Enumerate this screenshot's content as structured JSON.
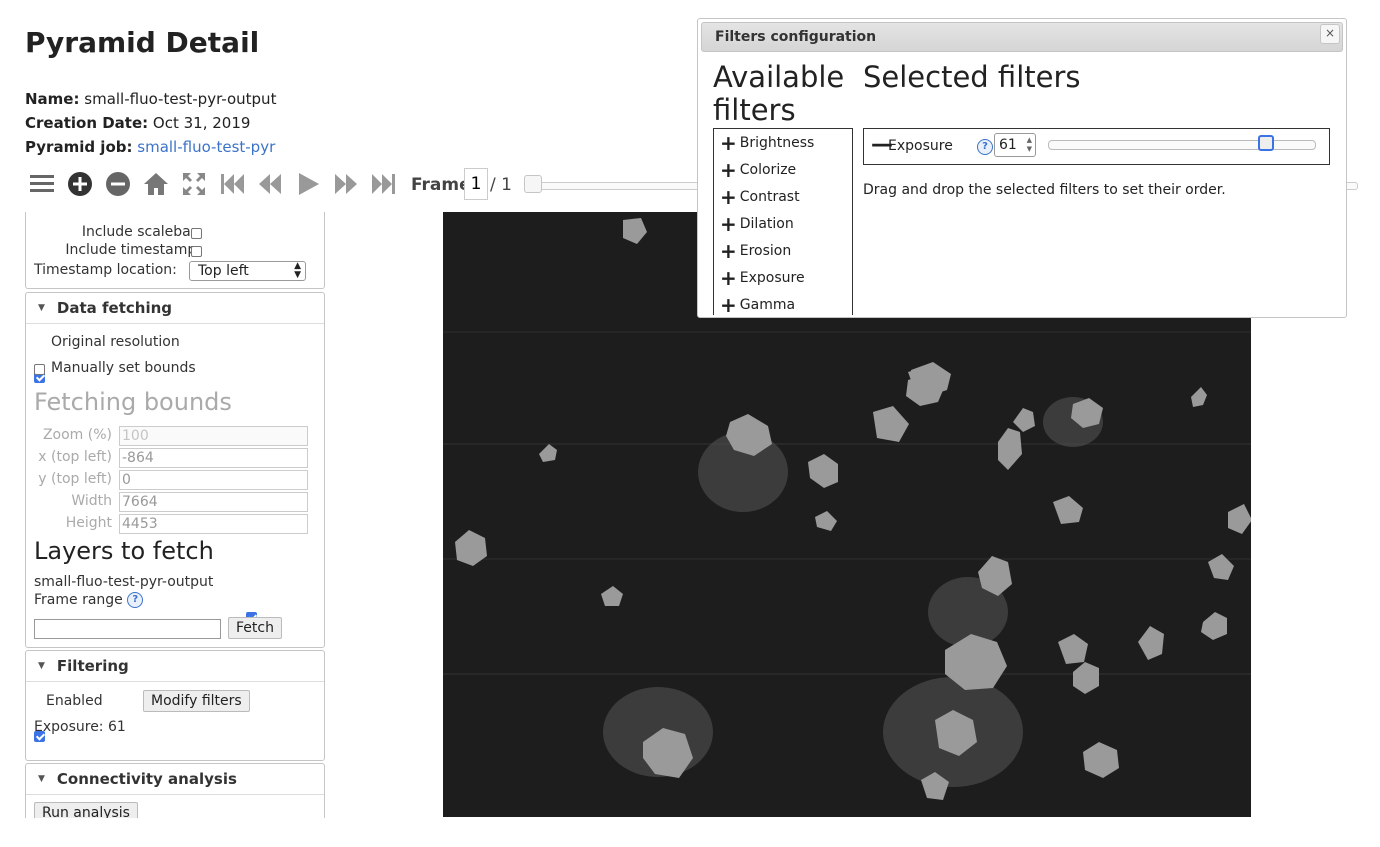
{
  "page": {
    "title": "Pyramid Detail",
    "name_label": "Name:",
    "name_value": "small-fluo-test-pyr-output",
    "date_label": "Creation Date:",
    "date_value": "Oct 31, 2019",
    "job_label": "Pyramid job:",
    "job_value": "small-fluo-test-pyr"
  },
  "toolbar": {
    "icons": [
      "menu-icon",
      "zoom-in-icon",
      "zoom-out-icon",
      "home-icon",
      "fullscreen-icon",
      "first-frame-icon",
      "previous-frame-icon",
      "play-icon",
      "next-frame-icon",
      "last-frame-icon"
    ],
    "frame_label": "Frame",
    "frame_value": "1",
    "frame_total": "/ 1"
  },
  "export_panel": {
    "scalebar_label": "Include scalebar:",
    "timestamp_label": "Include timestamp:",
    "timestamp_location_label": "Timestamp location:",
    "timestamp_location_value": "Top left"
  },
  "data_fetching": {
    "header": "Data fetching",
    "original_resolution": "Original resolution",
    "manual_bounds": "Manually set bounds",
    "bounds_title": "Fetching bounds",
    "fields": [
      {
        "label": "Zoom (%)",
        "value": "100"
      },
      {
        "label": "x (top left)",
        "value": "-864"
      },
      {
        "label": "y (top left)",
        "value": "0"
      },
      {
        "label": "Width",
        "value": "7664"
      },
      {
        "label": "Height",
        "value": "4453"
      }
    ],
    "layers_title": "Layers to fetch",
    "layer_name": "small-fluo-test-pyr-output",
    "frame_range_label": "Frame range",
    "fetch_button": "Fetch"
  },
  "filtering": {
    "header": "Filtering",
    "enabled_label": "Enabled",
    "modify_button": "Modify filters",
    "exposure_text": "Exposure: 61"
  },
  "connectivity": {
    "header": "Connectivity analysis",
    "run_button": "Run analysis"
  },
  "dialog": {
    "title": "Filters configuration",
    "close": "×",
    "available_title": "Available filters",
    "selected_title": "Selected filters",
    "available": [
      "Brightness",
      "Colorize",
      "Contrast",
      "Dilation",
      "Erosion",
      "Exposure",
      "Gamma"
    ],
    "selected_name": "Exposure",
    "selected_value": "61",
    "slider_fraction": 0.82,
    "hint": "Drag and drop the selected filters to set their order."
  },
  "colors": {
    "link": "#3b73c9",
    "checkbox": "#3b73e6",
    "image_bg": "#1e1e1e"
  }
}
